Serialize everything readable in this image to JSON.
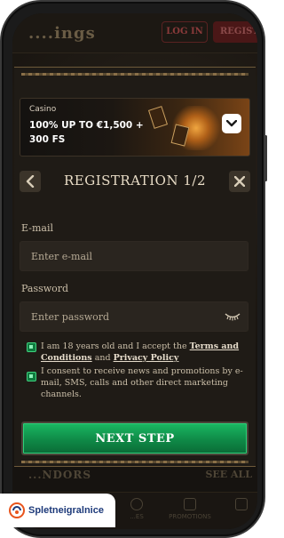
{
  "background_page": {
    "logo_text": "....ings",
    "login_label": "LOG IN",
    "register_label": "REGIST...",
    "section_title": "...NDORS",
    "see_all_label": "SEE ALL",
    "nav_items": [
      "",
      "...ES",
      "PROMOTIONS",
      ""
    ]
  },
  "promo": {
    "category": "Casino",
    "offer": "100% UP TO €1,500 + 300 FS",
    "toggle_icon": "chevron-down-icon"
  },
  "modal": {
    "title": "REGISTRATION 1/2",
    "back_icon": "chevron-left-icon",
    "close_icon": "close-icon"
  },
  "form": {
    "email_label": "E-mail",
    "email_placeholder": "Enter e-mail",
    "password_label": "Password",
    "password_placeholder": "Enter password",
    "password_toggle_icon": "eye-closed-icon",
    "terms_prefix": "I am 18 years old and I accept the",
    "terms_link": "Terms and Conditions",
    "terms_and": "and",
    "privacy_link": "Privacy Policy",
    "marketing_text": "I consent to receive news and promotions by e-mail, SMS, calls and other direct marketing channels.",
    "terms_checked": true,
    "marketing_checked": true,
    "next_label": "NEXT STEP"
  },
  "brand_badge": {
    "text": "Spletneigralnice"
  },
  "colors": {
    "accent_green": "#0f8a47",
    "gold": "#8a7048",
    "modal_bg": "#1f1b16"
  }
}
